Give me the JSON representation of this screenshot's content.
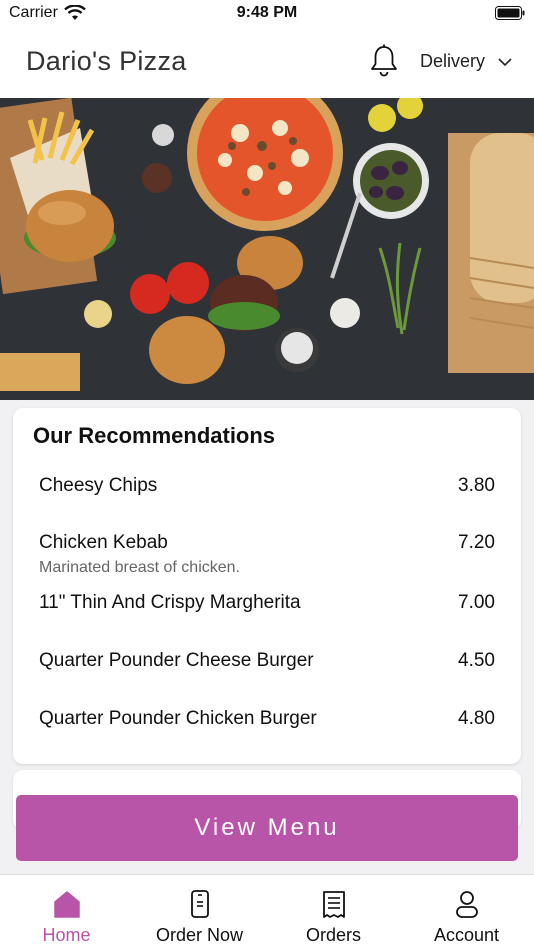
{
  "status_bar": {
    "carrier": "Carrier",
    "time": "9:48 PM"
  },
  "header": {
    "title": "Dario's Pizza",
    "delivery_label": "Delivery"
  },
  "hero": {
    "icon": "food-banner-image"
  },
  "recommendations": {
    "title": "Our Recommendations",
    "items": [
      {
        "name": "Cheesy Chips",
        "description": "",
        "price": "3.80"
      },
      {
        "name": "Chicken Kebab",
        "description": "Marinated breast of chicken.",
        "price": "7.20"
      },
      {
        "name": "11\" Thin And Crispy Margherita",
        "description": "",
        "price": "7.00"
      },
      {
        "name": "Quarter Pounder Cheese Burger",
        "description": "",
        "price": "4.50"
      },
      {
        "name": "Quarter Pounder Chicken Burger",
        "description": "",
        "price": "4.80"
      }
    ]
  },
  "view_menu_label": "View Menu",
  "tabs": [
    {
      "label": "Home",
      "icon": "home-icon",
      "active": true
    },
    {
      "label": "Order Now",
      "icon": "phone-icon",
      "active": false
    },
    {
      "label": "Orders",
      "icon": "receipt-icon",
      "active": false
    },
    {
      "label": "Account",
      "icon": "person-icon",
      "active": false
    }
  ],
  "colors": {
    "accent": "#b955a8",
    "text": "#111111",
    "muted": "#666666",
    "background": "#f1f1f3"
  }
}
